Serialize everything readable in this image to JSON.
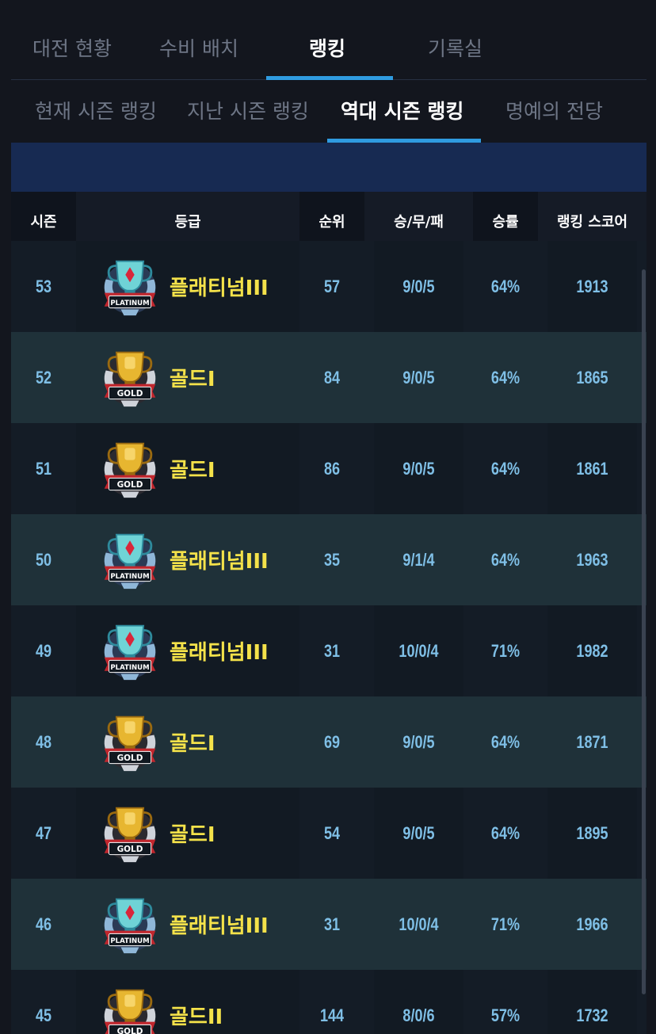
{
  "tabs_main": [
    {
      "label": "대전 현황",
      "active": false
    },
    {
      "label": "수비 배치",
      "active": false
    },
    {
      "label": "랭킹",
      "active": true
    },
    {
      "label": "기록실",
      "active": false
    }
  ],
  "tabs_sub": [
    {
      "label": "현재 시즌 랭킹",
      "active": false
    },
    {
      "label": "지난 시즌 랭킹",
      "active": false
    },
    {
      "label": "역대 시즌 랭킹",
      "active": true
    },
    {
      "label": "명예의 전당",
      "active": false
    }
  ],
  "table": {
    "headers": [
      "시즌",
      "등급",
      "순위",
      "승/무/패",
      "승률",
      "랭킹 스코어"
    ],
    "badge_text": {
      "platinum": "PLATINUM",
      "gold": "GOLD"
    },
    "rows": [
      {
        "season": "53",
        "tier": "platinum",
        "grade": "플래티넘III",
        "rank": "57",
        "wdl": "9/0/5",
        "rate": "64%",
        "score": "1913"
      },
      {
        "season": "52",
        "tier": "gold",
        "grade": "골드I",
        "rank": "84",
        "wdl": "9/0/5",
        "rate": "64%",
        "score": "1865"
      },
      {
        "season": "51",
        "tier": "gold",
        "grade": "골드I",
        "rank": "86",
        "wdl": "9/0/5",
        "rate": "64%",
        "score": "1861"
      },
      {
        "season": "50",
        "tier": "platinum",
        "grade": "플래티넘III",
        "rank": "35",
        "wdl": "9/1/4",
        "rate": "64%",
        "score": "1963"
      },
      {
        "season": "49",
        "tier": "platinum",
        "grade": "플래티넘III",
        "rank": "31",
        "wdl": "10/0/4",
        "rate": "71%",
        "score": "1982"
      },
      {
        "season": "48",
        "tier": "gold",
        "grade": "골드I",
        "rank": "69",
        "wdl": "9/0/5",
        "rate": "64%",
        "score": "1871"
      },
      {
        "season": "47",
        "tier": "gold",
        "grade": "골드I",
        "rank": "54",
        "wdl": "9/0/5",
        "rate": "64%",
        "score": "1895"
      },
      {
        "season": "46",
        "tier": "platinum",
        "grade": "플래티넘III",
        "rank": "31",
        "wdl": "10/0/4",
        "rate": "71%",
        "score": "1966"
      },
      {
        "season": "45",
        "tier": "gold",
        "grade": "골드II",
        "rank": "144",
        "wdl": "8/0/6",
        "rate": "57%",
        "score": "1732"
      }
    ]
  },
  "colors": {
    "accent": "#2f9be0",
    "grade_text": "#f4e24a",
    "stat_text": "#7fbfe6",
    "banner": "#172a52"
  }
}
